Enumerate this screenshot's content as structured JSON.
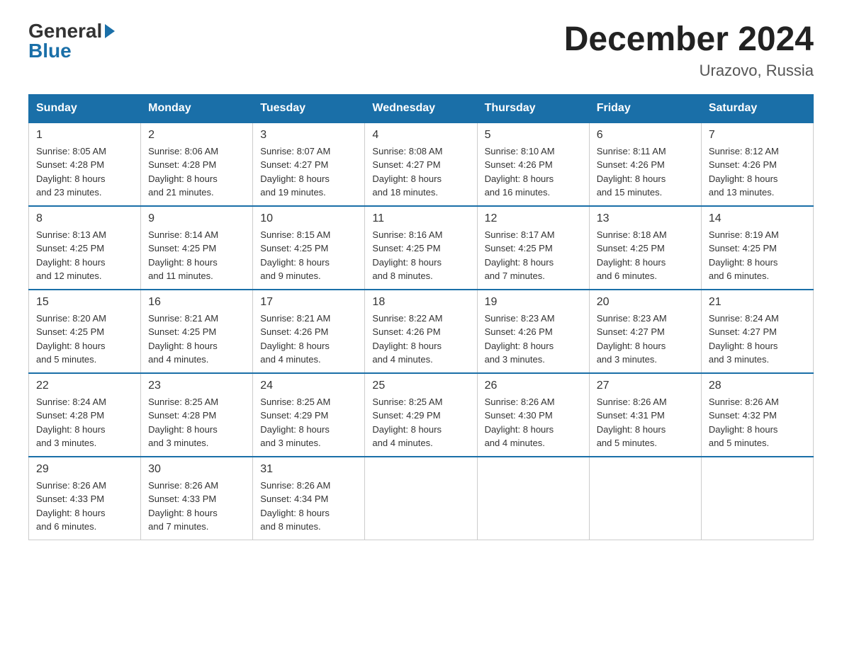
{
  "logo": {
    "general": "General",
    "blue": "Blue"
  },
  "title": "December 2024",
  "subtitle": "Urazovo, Russia",
  "days_of_week": [
    "Sunday",
    "Monday",
    "Tuesday",
    "Wednesday",
    "Thursday",
    "Friday",
    "Saturday"
  ],
  "weeks": [
    [
      {
        "day": "1",
        "info": "Sunrise: 8:05 AM\nSunset: 4:28 PM\nDaylight: 8 hours\nand 23 minutes."
      },
      {
        "day": "2",
        "info": "Sunrise: 8:06 AM\nSunset: 4:28 PM\nDaylight: 8 hours\nand 21 minutes."
      },
      {
        "day": "3",
        "info": "Sunrise: 8:07 AM\nSunset: 4:27 PM\nDaylight: 8 hours\nand 19 minutes."
      },
      {
        "day": "4",
        "info": "Sunrise: 8:08 AM\nSunset: 4:27 PM\nDaylight: 8 hours\nand 18 minutes."
      },
      {
        "day": "5",
        "info": "Sunrise: 8:10 AM\nSunset: 4:26 PM\nDaylight: 8 hours\nand 16 minutes."
      },
      {
        "day": "6",
        "info": "Sunrise: 8:11 AM\nSunset: 4:26 PM\nDaylight: 8 hours\nand 15 minutes."
      },
      {
        "day": "7",
        "info": "Sunrise: 8:12 AM\nSunset: 4:26 PM\nDaylight: 8 hours\nand 13 minutes."
      }
    ],
    [
      {
        "day": "8",
        "info": "Sunrise: 8:13 AM\nSunset: 4:25 PM\nDaylight: 8 hours\nand 12 minutes."
      },
      {
        "day": "9",
        "info": "Sunrise: 8:14 AM\nSunset: 4:25 PM\nDaylight: 8 hours\nand 11 minutes."
      },
      {
        "day": "10",
        "info": "Sunrise: 8:15 AM\nSunset: 4:25 PM\nDaylight: 8 hours\nand 9 minutes."
      },
      {
        "day": "11",
        "info": "Sunrise: 8:16 AM\nSunset: 4:25 PM\nDaylight: 8 hours\nand 8 minutes."
      },
      {
        "day": "12",
        "info": "Sunrise: 8:17 AM\nSunset: 4:25 PM\nDaylight: 8 hours\nand 7 minutes."
      },
      {
        "day": "13",
        "info": "Sunrise: 8:18 AM\nSunset: 4:25 PM\nDaylight: 8 hours\nand 6 minutes."
      },
      {
        "day": "14",
        "info": "Sunrise: 8:19 AM\nSunset: 4:25 PM\nDaylight: 8 hours\nand 6 minutes."
      }
    ],
    [
      {
        "day": "15",
        "info": "Sunrise: 8:20 AM\nSunset: 4:25 PM\nDaylight: 8 hours\nand 5 minutes."
      },
      {
        "day": "16",
        "info": "Sunrise: 8:21 AM\nSunset: 4:25 PM\nDaylight: 8 hours\nand 4 minutes."
      },
      {
        "day": "17",
        "info": "Sunrise: 8:21 AM\nSunset: 4:26 PM\nDaylight: 8 hours\nand 4 minutes."
      },
      {
        "day": "18",
        "info": "Sunrise: 8:22 AM\nSunset: 4:26 PM\nDaylight: 8 hours\nand 4 minutes."
      },
      {
        "day": "19",
        "info": "Sunrise: 8:23 AM\nSunset: 4:26 PM\nDaylight: 8 hours\nand 3 minutes."
      },
      {
        "day": "20",
        "info": "Sunrise: 8:23 AM\nSunset: 4:27 PM\nDaylight: 8 hours\nand 3 minutes."
      },
      {
        "day": "21",
        "info": "Sunrise: 8:24 AM\nSunset: 4:27 PM\nDaylight: 8 hours\nand 3 minutes."
      }
    ],
    [
      {
        "day": "22",
        "info": "Sunrise: 8:24 AM\nSunset: 4:28 PM\nDaylight: 8 hours\nand 3 minutes."
      },
      {
        "day": "23",
        "info": "Sunrise: 8:25 AM\nSunset: 4:28 PM\nDaylight: 8 hours\nand 3 minutes."
      },
      {
        "day": "24",
        "info": "Sunrise: 8:25 AM\nSunset: 4:29 PM\nDaylight: 8 hours\nand 3 minutes."
      },
      {
        "day": "25",
        "info": "Sunrise: 8:25 AM\nSunset: 4:29 PM\nDaylight: 8 hours\nand 4 minutes."
      },
      {
        "day": "26",
        "info": "Sunrise: 8:26 AM\nSunset: 4:30 PM\nDaylight: 8 hours\nand 4 minutes."
      },
      {
        "day": "27",
        "info": "Sunrise: 8:26 AM\nSunset: 4:31 PM\nDaylight: 8 hours\nand 5 minutes."
      },
      {
        "day": "28",
        "info": "Sunrise: 8:26 AM\nSunset: 4:32 PM\nDaylight: 8 hours\nand 5 minutes."
      }
    ],
    [
      {
        "day": "29",
        "info": "Sunrise: 8:26 AM\nSunset: 4:33 PM\nDaylight: 8 hours\nand 6 minutes."
      },
      {
        "day": "30",
        "info": "Sunrise: 8:26 AM\nSunset: 4:33 PM\nDaylight: 8 hours\nand 7 minutes."
      },
      {
        "day": "31",
        "info": "Sunrise: 8:26 AM\nSunset: 4:34 PM\nDaylight: 8 hours\nand 8 minutes."
      },
      null,
      null,
      null,
      null
    ]
  ]
}
